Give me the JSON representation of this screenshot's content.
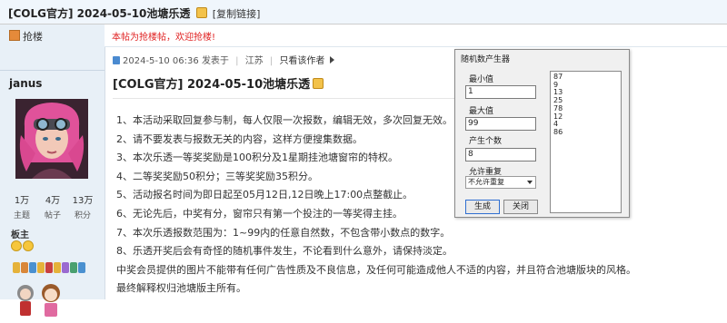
{
  "titlebar": {
    "title": "[COLG官方] 2024-05-10池塘乐透",
    "copy_link": "[复制链接]"
  },
  "left": {
    "grab_label": "抢楼",
    "username": "janus",
    "stats": [
      {
        "value": "1万",
        "label": "主题"
      },
      {
        "value": "4万",
        "label": "帖子"
      },
      {
        "value": "13万",
        "label": "积分"
      }
    ],
    "role": "板主"
  },
  "notice": "本帖为抢楼帖，欢迎抢楼!",
  "post": {
    "date": "2024-5-10 06:36",
    "posted_in": "发表于",
    "location": "江苏",
    "only_author": "只看该作者",
    "title": "[COLG官方] 2024-05-10池塘乐透",
    "lines": [
      "1、本活动采取回复参与制，每人仅限一次报数，编辑无效，多次回复无效。",
      "2、请不要发表与报数无关的内容，这样方便搜集数据。",
      "3、本次乐透一等奖奖励是100积分及1星期挂池塘窗帘的特权。",
      "4、二等奖奖励50积分；三等奖奖励35积分。",
      "5、活动报名时间为即日起至05月12日,12日晚上17:00点整截止。",
      "6、无论先后，中奖有分，窗帘只有第一个投注的一等奖得主挂。",
      "7、本次乐透报数范围为：1~99内的任意自然数，不包含带小数点的数字。",
      "8、乐透开奖后会有奇怪的随机事件发生，不论看到什么意外，请保持淡定。",
      "中奖会员提供的图片不能带有任何广告性质及不良信息，及任何可能造成他人不适的内容，并且符合池塘版块的风格。",
      "最终解释权归池塘版主所有。"
    ]
  },
  "dialog": {
    "title": "随机数产生器",
    "min_label": "最小值",
    "min_value": "1",
    "max_label": "最大值",
    "max_value": "99",
    "count_label": "产生个数",
    "count_value": "8",
    "allow_repeat_label": "允许重复",
    "allow_repeat_value": "不允许重复",
    "generate_button": "生成",
    "close_button": "关闭",
    "results": [
      "87",
      "9",
      "13",
      "25",
      "78",
      "12",
      "4",
      "86"
    ]
  },
  "colors": {
    "accent_red": "#e02020",
    "sidebar_bg": "#e8f0f7",
    "titlebar_bg": "#f0f6fc"
  }
}
